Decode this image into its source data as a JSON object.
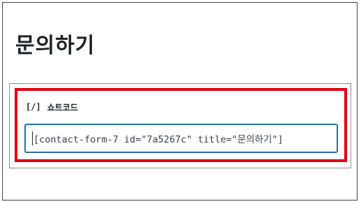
{
  "page": {
    "title": "문의하기"
  },
  "shortcode_panel": {
    "icon": "[/]",
    "icon_name": "shortcode-icon",
    "heading": "쇼트코드",
    "value": "[contact-form-7 id=\"7a5267c\" title=\"문의하기\"]"
  },
  "colors": {
    "highlight": "#e60012",
    "input_focus_border": "#2271b1",
    "title_text": "#1d2327"
  }
}
